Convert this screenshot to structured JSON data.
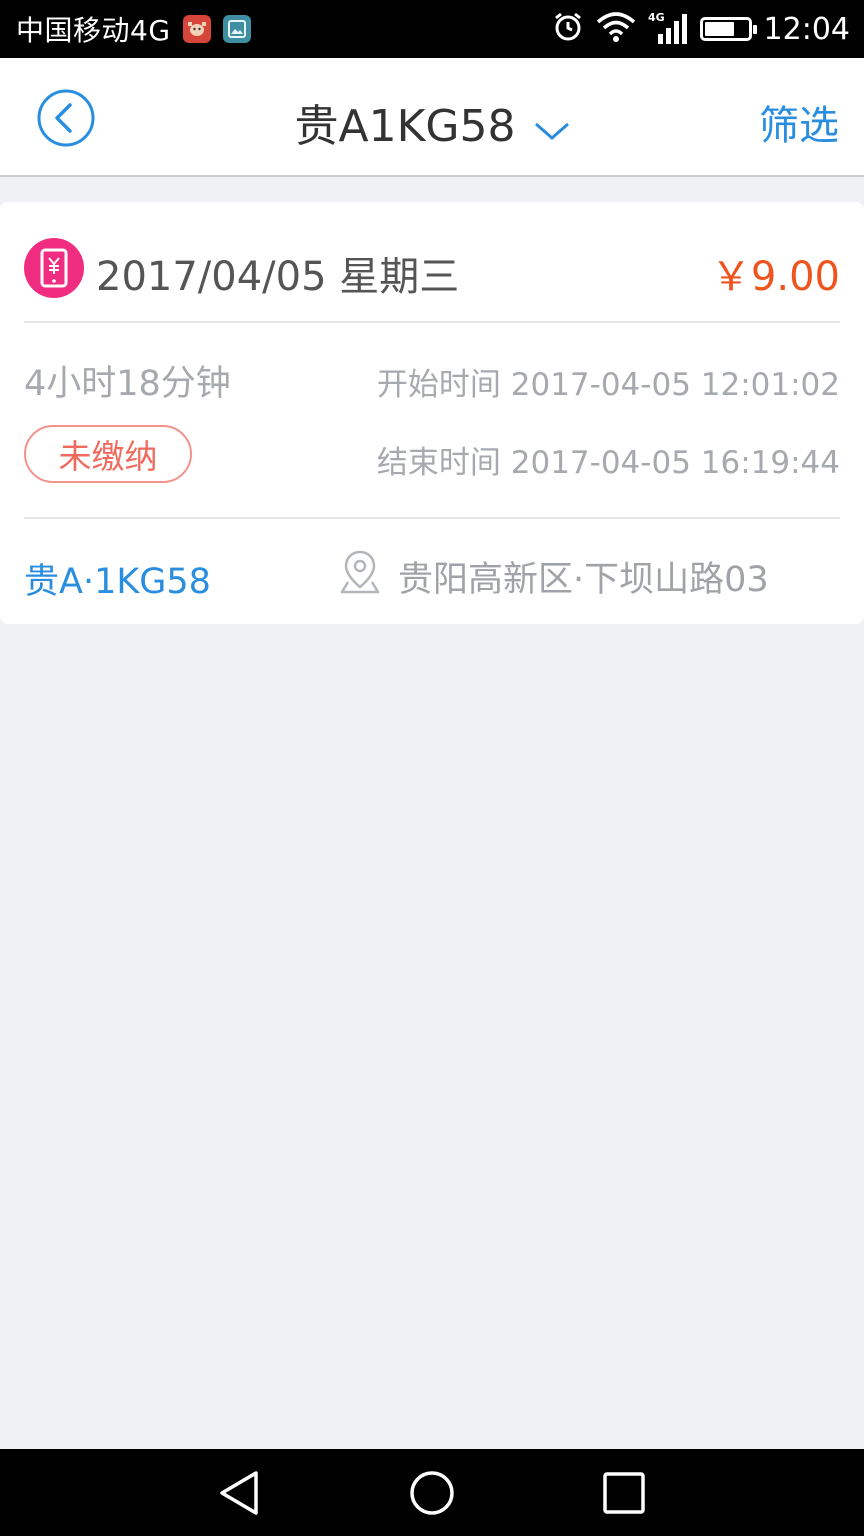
{
  "status_bar": {
    "carrier": "中国移动4G",
    "network": "4G",
    "time": "12:04",
    "battery_level": 0.7
  },
  "header": {
    "plate_title": "贵A1KG58",
    "filter_label": "筛选"
  },
  "record": {
    "date": "2017/04/05 星期三",
    "amount": "￥9.00",
    "duration": "4小时18分钟",
    "start_time": "开始时间 2017-04-05 12:01:02",
    "end_time": "结束时间 2017-04-05 16:19:44",
    "status": "未缴纳",
    "plate": "贵A·1KG58",
    "location": "贵阳高新区·下坝山路03"
  },
  "colors": {
    "accent": "#2a8ee0",
    "amount": "#f0541e",
    "status": "#f06b5e",
    "pay_icon": "#f02d81"
  },
  "icons": {
    "back": "chevron-left-circle-icon",
    "dropdown": "chevron-down-icon",
    "pay": "mobile-payment-icon",
    "location": "map-pin-icon"
  }
}
